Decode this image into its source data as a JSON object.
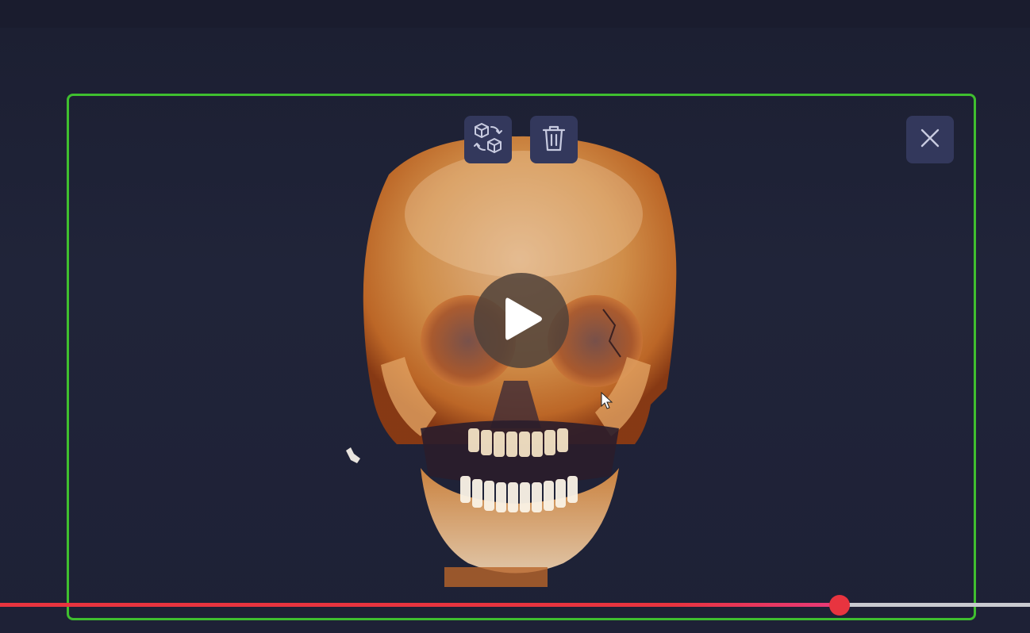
{
  "window": {
    "title": ""
  },
  "viewer": {
    "frame_color": "#3fbf2f",
    "image_subject": "3d-skull-volume-render",
    "toolbar": {
      "swap_model_icon": "swap-3d-model-icon",
      "delete_icon": "trash-icon",
      "close_icon": "close-icon"
    },
    "play_icon": "play-icon"
  },
  "playback": {
    "progress": 0.815,
    "played_color": "#e8343f",
    "remaining_color": "#c9cad0"
  },
  "colors": {
    "background": "#1b1e33",
    "button_bg": "#33385c",
    "accent": "#3fbf2f"
  }
}
